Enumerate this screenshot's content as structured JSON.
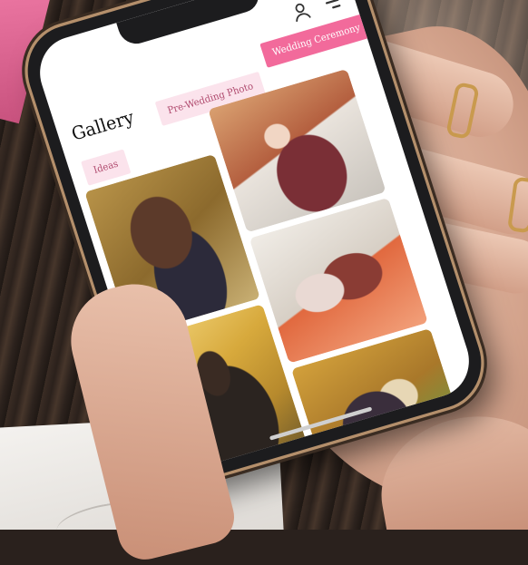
{
  "page": {
    "title": "Gallery"
  },
  "header": {
    "icons": [
      "user-icon",
      "menu-icon"
    ]
  },
  "tabs": [
    {
      "label": "Wedding Ceremony",
      "active": true
    },
    {
      "label": "Pre-Wedding Photo",
      "active": false
    },
    {
      "label": "Ideas",
      "active": false
    }
  ],
  "gallery": {
    "photos": [
      "bride-with-companion-photo",
      "bride-in-lehenga-photo",
      "couple-on-carpet-photo",
      "bride-in-marigold-decor-photo",
      "bride-seated-outdoor-photo"
    ]
  },
  "colors": {
    "accent": "#f26a9b",
    "tab_inactive_bg": "#fbe3ec",
    "tab_inactive_text": "#b04a6e",
    "screen_bg": "#ffffff",
    "frame": "#1c1c1e"
  }
}
